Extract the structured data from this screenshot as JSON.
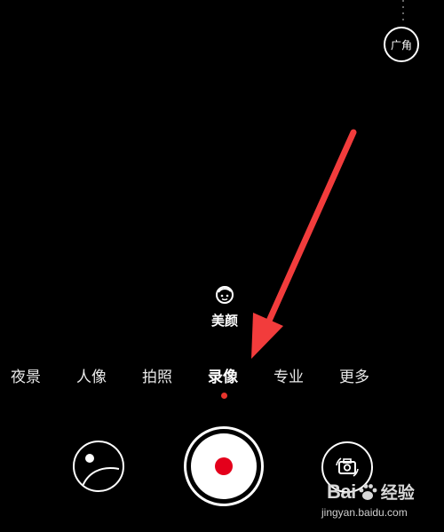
{
  "top_controls": {
    "wide_angle_label": "广角"
  },
  "beauty": {
    "label": "美颜"
  },
  "modes": [
    {
      "label": "夜景",
      "active": false
    },
    {
      "label": "人像",
      "active": false
    },
    {
      "label": "拍照",
      "active": false
    },
    {
      "label": "录像",
      "active": true
    },
    {
      "label": "专业",
      "active": false
    },
    {
      "label": "更多",
      "active": false
    }
  ],
  "colors": {
    "record_red": "#e4001b",
    "indicator_red": "#e8342c",
    "annotation_arrow": "#f23c3c",
    "background": "#000000"
  },
  "icons": [
    "gallery-icon",
    "record-shutter-icon",
    "camera-switch-icon",
    "beauty-face-icon"
  ],
  "watermark": {
    "brand_left": "Bai",
    "brand_right": "经验",
    "url": "jingyan.baidu.com"
  }
}
